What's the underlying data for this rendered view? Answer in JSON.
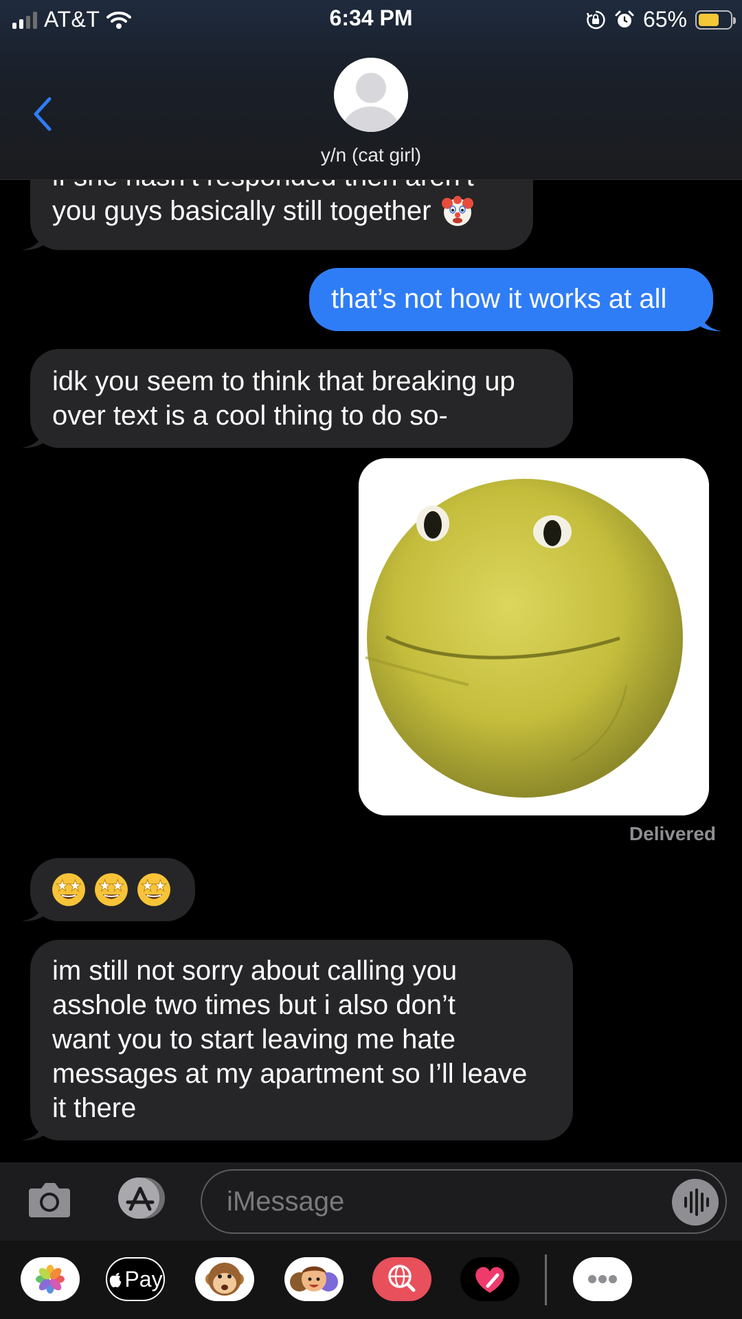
{
  "status_bar": {
    "carrier": "AT&T",
    "time": "6:34 PM",
    "battery_percent": "65%",
    "battery_level": 0.65,
    "battery_color": "#f3c735",
    "icons": [
      "signal-icon",
      "wifi-icon",
      "orientation-lock-icon",
      "alarm-icon",
      "battery-icon"
    ]
  },
  "header": {
    "back_icon": "chevron-left-icon",
    "contact_name": "y/n (cat girl)",
    "avatar_icon": "person-icon",
    "accent_color": "#2f7df6"
  },
  "messages": [
    {
      "direction": "received",
      "lines": [
        "if she hasn’t responded then aren’t",
        "you guys basically still together"
      ],
      "emoji": "clown-face"
    },
    {
      "direction": "sent",
      "lines": [
        "that’s not how it works at all"
      ]
    },
    {
      "direction": "received",
      "lines": [
        "idk you seem to think that breaking up",
        "over text is a cool thing to do so-"
      ]
    },
    {
      "direction": "sent",
      "type": "image",
      "image_description": "yellow-smiley-meme-image"
    },
    {
      "direction": "received",
      "type": "emoji",
      "emoji": [
        "star-struck",
        "star-struck",
        "star-struck"
      ]
    },
    {
      "direction": "received",
      "lines": [
        "im still not sorry about calling you",
        "asshole two times but i also don’t",
        "want you to start leaving me hate",
        "messages at my apartment so I’ll leave",
        "it there"
      ]
    }
  ],
  "delivered_label": "Delivered",
  "input_bar": {
    "placeholder": "iMessage",
    "camera_icon": "camera-icon",
    "apps_icon": "app-store-icon",
    "audio_icon": "audio-waveform-icon"
  },
  "app_strip": {
    "apple_pay_label": "Pay",
    "apps": [
      "photos-icon",
      "apple-pay-icon",
      "animoji-monkey-icon",
      "memoji-icon",
      "web-search-icon",
      "digital-touch-icon",
      "more-icon"
    ]
  }
}
